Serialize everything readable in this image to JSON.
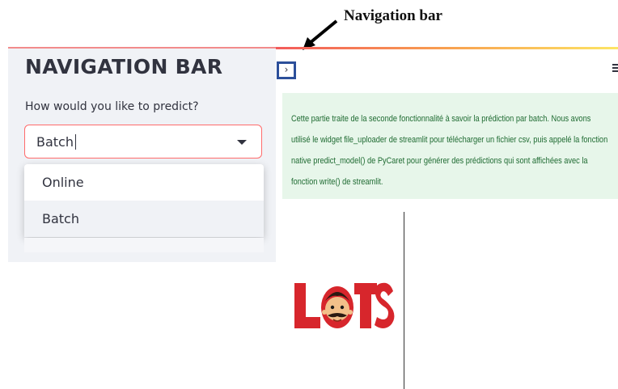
{
  "annotation": {
    "label": "Navigation bar"
  },
  "sidebar": {
    "title": "NAVIGATION BAR",
    "question": "How would you like to predict?",
    "select": {
      "value": "Batch",
      "options": [
        "Online",
        "Batch"
      ]
    }
  },
  "main": {
    "expand_button": "›",
    "info_text": "Cette partie traite de la seconde fonctionnalité à savoir la prédiction par batch. Nous avons utilisé le widget file_uploader de streamlit pour télécharger un fichier csv, puis appelé la fonction native predict_model() de PyCaret pour générer des prédictions qui sont affichées avec la fonction write() de streamlit.",
    "logo_text": "LOTS"
  },
  "colors": {
    "accent_border": "#ff6b6b",
    "info_bg": "#e7f6ea",
    "info_text": "#1f6b32",
    "logo_red": "#d7262c"
  }
}
